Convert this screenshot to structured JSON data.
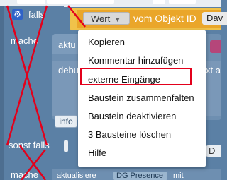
{
  "canvas_labels": {
    "if_label": "falls",
    "do_label": "mache",
    "do_label_bottom": "mache",
    "else_if_label": "sonst falls",
    "partial_update": "aktu",
    "partial_debug": "debu",
    "partial_text_right": "xt a",
    "info_chip": "info",
    "right_partial_d": "D",
    "bottom_row_text": "aktualisiere",
    "bottom_pill": "DG Presence",
    "bottom_tail": "mit"
  },
  "value_block": {
    "dropdown_value": "Wert",
    "object_label": "vom Objekt ID",
    "object_value": "Dav"
  },
  "context_menu": {
    "items": [
      "Kopieren",
      "Kommentar hinzufügen",
      "externe Eingänge",
      "Baustein zusammenfalten",
      "Baustein deaktivieren",
      "3 Bausteine löschen",
      "Hilfe"
    ],
    "highlighted_index": 2
  },
  "colors": {
    "workspace_block": "#5b80a5",
    "value_block": "#eaa62a",
    "highlight_border": "#e3001b",
    "annotation_cross": "#e3001b"
  }
}
